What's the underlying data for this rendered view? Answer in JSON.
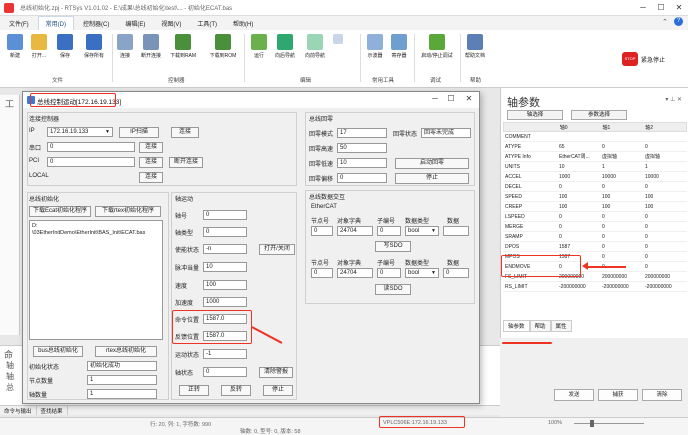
{
  "app": {
    "title": "总线初始化.zpj - RTSys V1.01.02 - E:\\成果\\总线初始化\\test\\... - 初始化ECAT.bas"
  },
  "menu": [
    {
      "label": "文件(F)"
    },
    {
      "label": "常用(D)",
      "active": true
    },
    {
      "label": "控制器(C)"
    },
    {
      "label": "编辑(E)"
    },
    {
      "label": "视图(V)"
    },
    {
      "label": "工具(T)"
    },
    {
      "label": "帮助(H)"
    }
  ],
  "ribbon": {
    "buttons": [
      "新建",
      "打开...",
      "保存",
      "保存所有",
      "连接",
      "断开连接",
      "下载到RAM",
      "下载到ROM",
      "运行",
      "向后导航",
      "向前导航",
      "",
      "",
      "示波器",
      "寄存器",
      "",
      "启动/停止调试",
      "帮助文档"
    ],
    "groups": [
      "文件",
      "控制器",
      "编辑",
      "常用工具",
      "调试",
      "帮助"
    ],
    "estop": "紧急停止"
  },
  "dialog": {
    "title": "总线控制运动[172.16.19.133]",
    "connect": {
      "title": "连接控制器",
      "ip_label": "IP",
      "ip_value": "172.16.19.133",
      "ip_scan": "IP扫描",
      "connect_btn": "连接",
      "com_label": "串口",
      "com_value": "0",
      "com_btn": "连接",
      "pci_label": "PCI",
      "pci_value": "0",
      "pci_btn": "连接",
      "disconnect_btn": "断开连接",
      "local_label": "LOCAL",
      "local_btn": "连接"
    },
    "busInit": {
      "title": "总线初始化",
      "dl_ecat": "下载Ecat初始化程序",
      "dl_rtex": "下载rtex初始化程序",
      "path": "D:\n\\03EtherInitDemo\\EtherInit\\BAS_Init\\ECAT.bas",
      "bus_btn": "bus总线初始化",
      "rtex_btn": "rtex总线初始化",
      "status_label": "初始化状态",
      "status_value": "初始化成功",
      "nodes_label": "节点数量",
      "nodes_value": "1",
      "axes_label": "轴数量",
      "axes_value": "1"
    },
    "motion": {
      "title": "轴运动",
      "axis_label": "轴号",
      "axis_value": "0",
      "type_label": "轴类型",
      "type_value": "0",
      "enable_label": "使能状态",
      "enable_value": "-n",
      "toggle_btn": "打开/关闭",
      "pulse_label": "脉冲当量",
      "pulse_value": "10",
      "speed_label": "速度",
      "speed_value": "100",
      "accel_label": "加速度",
      "accel_value": "1000",
      "cmd_label": "命令位置",
      "cmd_value": "1587.0",
      "fb_label": "反馈位置",
      "fb_value": "1587.0",
      "run_label": "运动状态",
      "run_value": "-1",
      "axis_state_label": "轴状态",
      "axis_state_value": "0",
      "clear_btn": "清除警报",
      "fwd_btn": "正转",
      "rev_btn": "反转",
      "stop_btn": "停止"
    },
    "home": {
      "title": "总线回零",
      "mode_label": "回零模式",
      "mode_value": "17",
      "state_label": "回零状态",
      "state_value": "回零未完成",
      "speed_label": "回零高速",
      "speed_value": "50",
      "low_label": "回零低速",
      "low_value": "10",
      "start_btn": "启动回零",
      "offset_label": "回零偏移",
      "offset_value": "0",
      "stop_btn": "停止"
    },
    "sdo": {
      "title": "总线数据交互",
      "ethercat": "EtherCAT",
      "cols": [
        "节点号",
        "对象字典",
        "子编号",
        "数据类型",
        "数据"
      ],
      "row1": [
        "0",
        "24704",
        "0",
        "bool",
        ""
      ],
      "write_btn": "写SDO",
      "row2": [
        "0",
        "24704",
        "0",
        "bool",
        "0"
      ],
      "read_btn": "读SDO"
    }
  },
  "axisParams": {
    "title": "轴参数",
    "btn_select": "轴选择",
    "btn_param": "参数选择",
    "headers": [
      "",
      "轴0",
      "轴1",
      "轴2"
    ],
    "rows": [
      [
        "COMMENT",
        "",
        "",
        ""
      ],
      [
        "ATYPE",
        "65",
        "0",
        "0"
      ],
      [
        "ATYPE Info",
        "EtherCAT周...",
        "虚拟轴",
        "虚拟轴"
      ],
      [
        "UNITS",
        "10",
        "1",
        "1"
      ],
      [
        "ACCEL",
        "1000",
        "10000",
        "10000"
      ],
      [
        "DECEL",
        "0",
        "0",
        "0"
      ],
      [
        "SPEED",
        "100",
        "100",
        "100"
      ],
      [
        "CREEP",
        "100",
        "100",
        "100"
      ],
      [
        "LSPEED",
        "0",
        "0",
        "0"
      ],
      [
        "MERGE",
        "0",
        "0",
        "0"
      ],
      [
        "SRAMP",
        "0",
        "0",
        "0"
      ],
      [
        "DPOS",
        "1587",
        "0",
        "0"
      ],
      [
        "MPOS",
        "1587",
        "0",
        "0"
      ],
      [
        "ENDMOVE",
        "0",
        "0",
        "0"
      ],
      [
        "FS_LIMIT",
        "200000000",
        "200000000",
        "200000000"
      ],
      [
        "RS_LIMIT",
        "-200000000",
        "-200000000",
        "-200000000"
      ]
    ],
    "tabs": [
      "轴参数",
      "帮助",
      "属性"
    ]
  },
  "command": {
    "send": "发送",
    "capture": "捕获",
    "clear": "清除",
    "tabs": [
      "命令与输出",
      "查找结果"
    ]
  },
  "status": {
    "pos": "行: 20, 列: 1, 字符数: 990",
    "info": "轴数: 0, 型号: 0, 版本: 58",
    "conn": "VPLC506E:172.16.19.133",
    "zoom": "100%"
  }
}
